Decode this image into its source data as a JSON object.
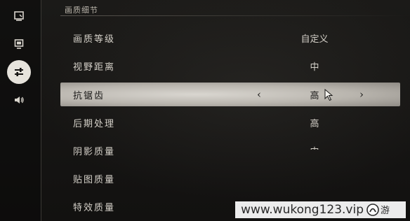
{
  "sidebar": {
    "items": [
      {
        "icon": "display-icon",
        "active": false
      },
      {
        "icon": "monitor-icon",
        "active": false
      },
      {
        "icon": "sliders-icon",
        "active": true
      },
      {
        "icon": "speaker-icon",
        "active": false
      }
    ]
  },
  "section": {
    "title": "画质细节"
  },
  "settings": [
    {
      "label": "画质等级",
      "value": "自定义"
    },
    {
      "label": "视野距离",
      "value": "中"
    },
    {
      "label": "抗锯齿",
      "value": "高",
      "prev_symbol": "‹",
      "next_symbol": "›"
    },
    {
      "label": "后期处理",
      "value": "高"
    },
    {
      "label": "阴影质量",
      "value": "中"
    },
    {
      "label": "贴图质量",
      "value": ""
    },
    {
      "label": "特效质量",
      "value": ""
    }
  ],
  "watermark": {
    "text": "www.wukong123.vip",
    "logo": "九游"
  },
  "colors": {
    "selected_row": "#c8c4bd",
    "active_icon_bg": "#e6e3dc",
    "background": "#141312"
  }
}
